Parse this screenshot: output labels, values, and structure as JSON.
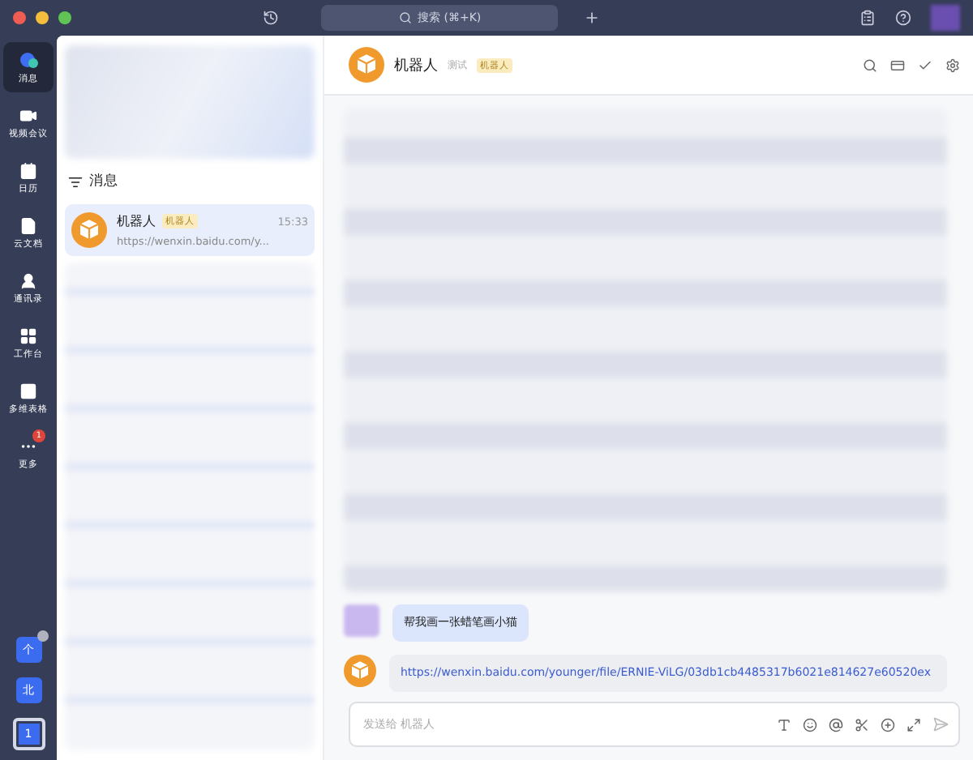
{
  "topbar": {
    "search": {
      "placeholder": "搜索 (⌘+K)"
    }
  },
  "sidebar": {
    "items": [
      {
        "label": "消息",
        "kind": "chat",
        "selected": true
      },
      {
        "label": "视频会议",
        "kind": "video",
        "selected": false
      },
      {
        "label": "日历",
        "kind": "calendar",
        "selected": false
      },
      {
        "label": "云文档",
        "kind": "docs",
        "selected": false
      },
      {
        "label": "通讯录",
        "kind": "contacts",
        "selected": false
      },
      {
        "label": "工作台",
        "kind": "apps",
        "selected": false
      },
      {
        "label": "多维表格",
        "kind": "table",
        "selected": false
      },
      {
        "label": "更多",
        "kind": "more",
        "selected": false,
        "badge": "1"
      }
    ],
    "accounts": [
      {
        "label": "个",
        "selected": false,
        "dot": true
      },
      {
        "label": "北",
        "selected": false,
        "dot": false
      },
      {
        "label": "1",
        "selected": true,
        "dot": false
      }
    ]
  },
  "list": {
    "header": "消息",
    "conversations": [
      {
        "name": "机器人",
        "tag": "机器人",
        "time": "15:33",
        "preview": "https://wenxin.baidu.com/y...",
        "selected": true
      }
    ]
  },
  "chat": {
    "title": "机器人",
    "subtitle": "测试",
    "tag": "机器人",
    "messages": [
      {
        "kind": "user",
        "text": "帮我画一张蜡笔画小猫"
      },
      {
        "kind": "bot",
        "text": "https://wenxin.baidu.com/younger/file/ERNIE-ViLG/03db1cb4485317b6021e814627e60520ex"
      }
    ],
    "composer": {
      "placeholder": "发送给 机器人"
    }
  }
}
